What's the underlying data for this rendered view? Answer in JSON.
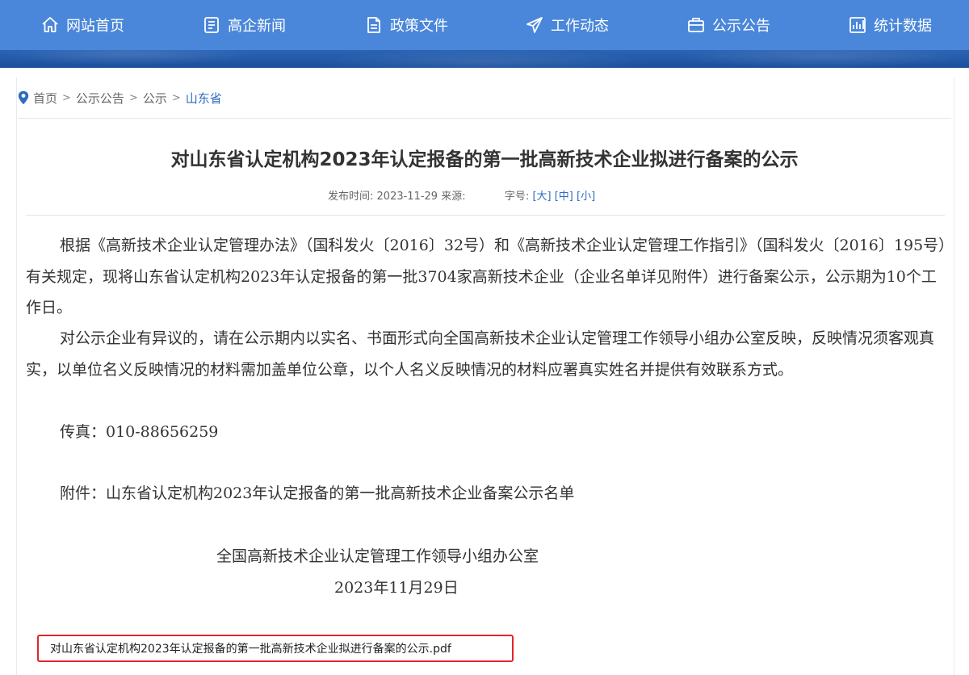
{
  "nav": {
    "items": [
      {
        "label": "网站首页",
        "icon": "home-icon"
      },
      {
        "label": "高企新闻",
        "icon": "news-icon"
      },
      {
        "label": "政策文件",
        "icon": "document-icon"
      },
      {
        "label": "工作动态",
        "icon": "send-icon"
      },
      {
        "label": "公示公告",
        "icon": "notice-icon"
      },
      {
        "label": "统计数据",
        "icon": "chart-icon"
      }
    ]
  },
  "breadcrumb": {
    "items": [
      "首页",
      "公示公告",
      "公示",
      "山东省"
    ],
    "separator": ">"
  },
  "article": {
    "title": "对山东省认定机构2023年认定报备的第一批高新技术企业拟进行备案的公示",
    "publish_label": "发布时间:",
    "publish_date": "2023-11-29",
    "source_label": "来源:",
    "font_size_label": "字号:",
    "size_large": "[大]",
    "size_medium": "[中]",
    "size_small": "[小]",
    "paragraphs": [
      "根据《高新技术企业认定管理办法》（国科发火〔2016〕32号）和《高新技术企业认定管理工作指引》（国科发火〔2016〕195号）有关规定，现将山东省认定机构2023年认定报备的第一批3704家高新技术企业（企业名单详见附件）进行备案公示，公示期为10个工作日。",
      "对公示企业有异议的，请在公示期内以实名、书面形式向全国高新技术企业认定管理工作领导小组办公室反映，反映情况须客观真实，以单位名义反映情况的材料需加盖单位公章，以个人名义反映情况的材料应署真实姓名并提供有效联系方式。",
      "传真：010-88656259",
      "附件：山东省认定机构2023年认定报备的第一批高新技术企业备案公示名单"
    ],
    "signature_org": "全国高新技术企业认定管理工作领导小组办公室",
    "signature_date": "2023年11月29日",
    "attachment_file": "对山东省认定机构2023年认定报备的第一批高新技术企业拟进行备案的公示.pdf"
  },
  "colors": {
    "nav_bg": "#4a87da",
    "stripe_bg": "#1b4f9e",
    "link": "#2f6bbf",
    "highlight_border": "#e0262b"
  }
}
